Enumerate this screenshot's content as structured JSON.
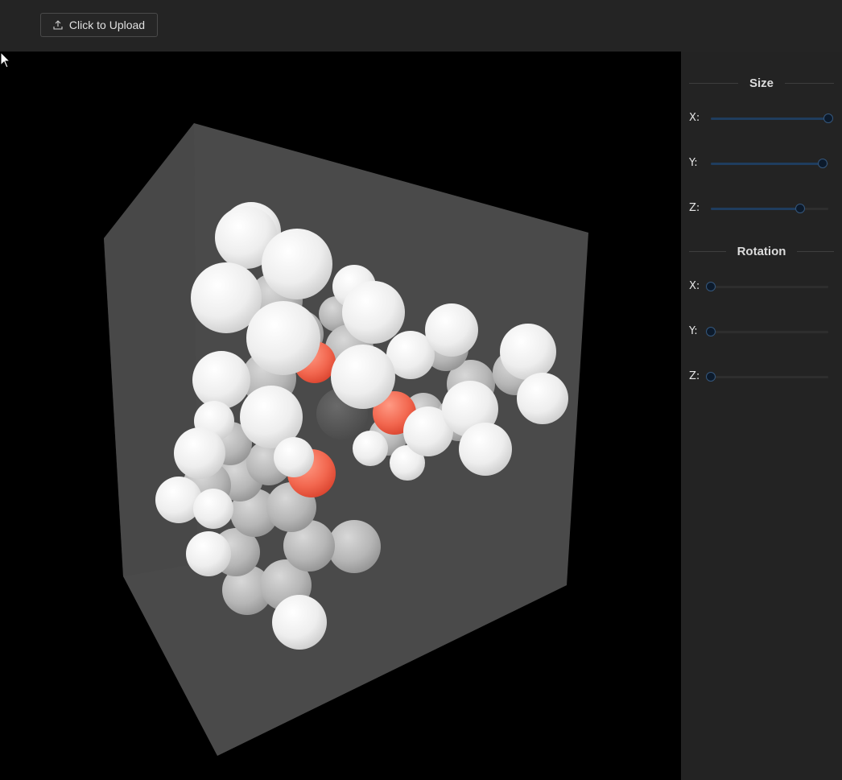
{
  "topbar": {
    "upload_label": "Click to Upload",
    "upload_icon": "upload-icon"
  },
  "panel": {
    "size": {
      "title": "Size",
      "sliders": [
        {
          "axis": "X:",
          "value": 1.0
        },
        {
          "axis": "Y:",
          "value": 0.95
        },
        {
          "axis": "Z:",
          "value": 0.76
        }
      ]
    },
    "rotation": {
      "title": "Rotation",
      "sliders": [
        {
          "axis": "X:",
          "value": 0.0
        },
        {
          "axis": "Y:",
          "value": 0.0
        },
        {
          "axis": "Z:",
          "value": 0.0
        }
      ]
    }
  },
  "viewport": {
    "description_colors": {
      "background": "#000000",
      "box": "#4a4a4a",
      "atom_white": "#f2f2f2",
      "atom_gray": "#b8b8b8",
      "atom_red": "#f0705a"
    }
  }
}
